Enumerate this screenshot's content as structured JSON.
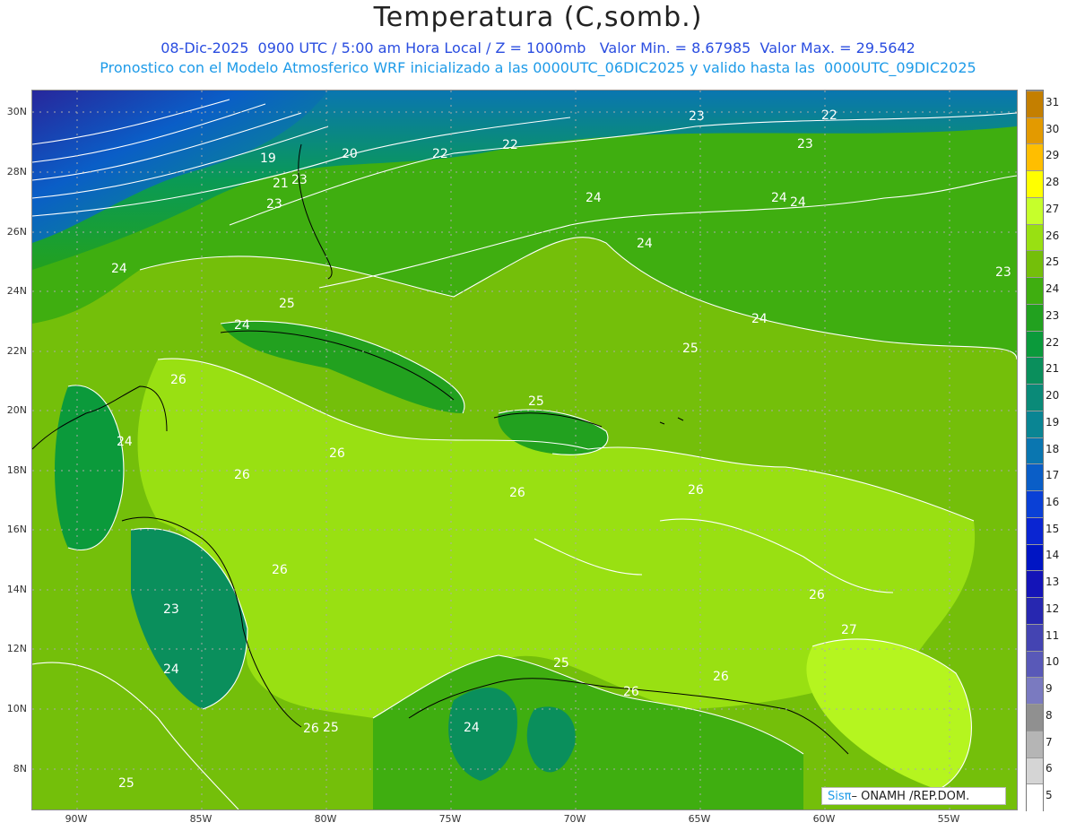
{
  "header": {
    "title": "Temperatura (C,somb.)",
    "line1": "08-Dic-2025  0900 UTC / 5:00 am Hora Local / Z = 1000mb   Valor Min. = 8.67985  Valor Max. = 29.5642",
    "line2": "Pronostico con el Modelo Atmosferico WRF inicializado a las 0000UTC_06DIC2025 y valido hasta las  0000UTC_09DIC2025"
  },
  "axes": {
    "lat_labels": [
      "30N",
      "28N",
      "26N",
      "24N",
      "22N",
      "20N",
      "18N",
      "16N",
      "14N",
      "12N",
      "10N",
      "8N"
    ],
    "lon_labels": [
      "90W",
      "85W",
      "80W",
      "75W",
      "70W",
      "65W",
      "60W",
      "55W"
    ]
  },
  "contour_labels": [
    "23",
    "22",
    "23",
    "20",
    "19",
    "22",
    "21",
    "23",
    "23",
    "22",
    "24",
    "24",
    "24",
    "24",
    "24",
    "23",
    "24",
    "25",
    "24",
    "25",
    "26",
    "26",
    "25",
    "26",
    "26",
    "26",
    "26",
    "23",
    "24",
    "26",
    "27",
    "25",
    "26",
    "26",
    "25",
    "26",
    "24",
    "25",
    "24"
  ],
  "colorbar": {
    "labels": [
      "31",
      "30",
      "29",
      "28",
      "27",
      "26",
      "25",
      "24",
      "23",
      "22",
      "21",
      "20",
      "19",
      "18",
      "17",
      "16",
      "15",
      "14",
      "13",
      "12",
      "11",
      "10",
      "9",
      "8",
      "7",
      "6",
      "5"
    ],
    "colors": [
      "#c47f00",
      "#e39a00",
      "#ffbe00",
      "#ffff00",
      "#c6ff2b",
      "#99e012",
      "#74bf0a",
      "#3fae10",
      "#22a11f",
      "#0b9a3b",
      "#0a8f5c",
      "#0a8a78",
      "#0a8593",
      "#0a76b0",
      "#0a5ec7",
      "#0a40d6",
      "#0a25d2",
      "#0015c4",
      "#1414b8",
      "#2727b0",
      "#4444b2",
      "#5959b8",
      "#7a7ac0",
      "#909090",
      "#b5b5b5",
      "#d5d5d5",
      "#ffffff"
    ]
  },
  "logo": {
    "sis": "Sisπ",
    "rest": " – ONAMH /REP.DOM."
  }
}
